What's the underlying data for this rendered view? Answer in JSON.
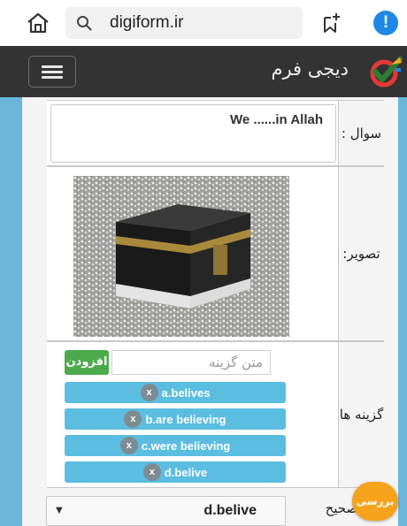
{
  "browser": {
    "url": "digiform.ir",
    "alert_symbol": "!"
  },
  "header": {
    "brand_name": "دیجی فرم",
    "icons": {
      "menu": "hamburger-icon",
      "logo": "checkmark-logo-icon"
    }
  },
  "form": {
    "question": {
      "label": "سوال :",
      "text": "We ......in Allah"
    },
    "image": {
      "label": "تصویر:"
    },
    "options": {
      "label": "گزینه ها",
      "input_placeholder": "متن گزینه",
      "add_label": "افزودن",
      "remove_symbol": "x",
      "items": [
        "a.belives",
        "b.are believing",
        "c.were believing",
        "d.belive"
      ]
    },
    "answer": {
      "label": "پاسخ صحیح",
      "selected": "d.belive"
    },
    "check_label": "بررسی"
  },
  "colors": {
    "header_bg": "#333333",
    "frame_bg": "#6ab7d9",
    "chip_bg": "#5bbde0",
    "add_button": "#4caa4c",
    "check_button": "#f7a21b"
  }
}
